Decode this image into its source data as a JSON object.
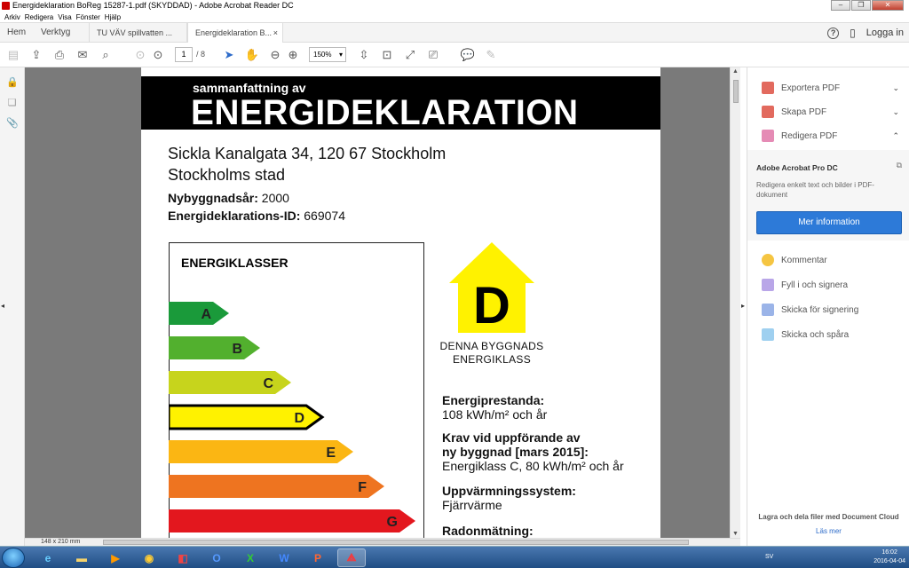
{
  "window": {
    "title": "Energideklaration BoReg 15287-1.pdf (SKYDDAD) - Adobe Acrobat Reader DC"
  },
  "menu": [
    "Arkiv",
    "Redigera",
    "Visa",
    "Fönster",
    "Hjälp"
  ],
  "tabs": {
    "home": "Hem",
    "tools": "Verktyg",
    "doc1": "TU VÄV spillvatten ...",
    "doc2": "Energideklaration B...",
    "close": "×",
    "login": "Logga in"
  },
  "toolbar": {
    "page_current": "1",
    "page_total": "/ 8",
    "zoom": "150%"
  },
  "document": {
    "banner_sub": "sammanfattning av",
    "banner_main": "ENERGIDEKLARATION",
    "address1": "Sickla Kanalgata 34, 120 67 Stockholm",
    "address2": "Stockholms stad",
    "year_label": "Nybyggnadsår:",
    "year_value": " 2000",
    "id_label": "Energideklarations-ID:",
    "id_value": " 669074",
    "classes_heading": "ENERGIKLASSER",
    "classes": [
      {
        "letter": "A",
        "color": "#1a9a3a"
      },
      {
        "letter": "B",
        "color": "#52b02e"
      },
      {
        "letter": "C",
        "color": "#c7d41c"
      },
      {
        "letter": "D",
        "color": "#fff200"
      },
      {
        "letter": "E",
        "color": "#fbb613"
      },
      {
        "letter": "F",
        "color": "#ee7420"
      },
      {
        "letter": "G",
        "color": "#e3171e"
      }
    ],
    "current_class": "D",
    "house_label1": "DENNA BYGGNADS",
    "house_label2": "ENERGIKLASS",
    "perf_label": "Energiprestanda:",
    "perf_value": "108 kWh/m² och år",
    "req_label1": "Krav vid uppförande av",
    "req_label2": "ny byggnad [mars 2015]:",
    "req_value": "Energiklass C, 80 kWh/m² och år",
    "heat_label": "Uppvärmningssystem:",
    "heat_value": "Fjärrvärme",
    "radon_label": "Radonmätning:"
  },
  "statusbar": {
    "dimensions": "148 x 210 mm"
  },
  "rightpanel": {
    "export": "Exportera PDF",
    "create": "Skapa PDF",
    "edit": "Redigera PDF",
    "pro_title": "Adobe Acrobat Pro DC",
    "pro_desc": "Redigera enkelt text och bilder i PDF-dokument",
    "pro_button": "Mer information",
    "comment": "Kommentar",
    "fill": "Fyll i och signera",
    "send_sign": "Skicka för signering",
    "send_track": "Skicka och spåra",
    "cloud_text": "Lagra och dela filer med Document Cloud",
    "cloud_link": "Läs mer"
  },
  "taskbar": {
    "lang": "SV",
    "time": "16:02",
    "date": "2016-04-04"
  }
}
